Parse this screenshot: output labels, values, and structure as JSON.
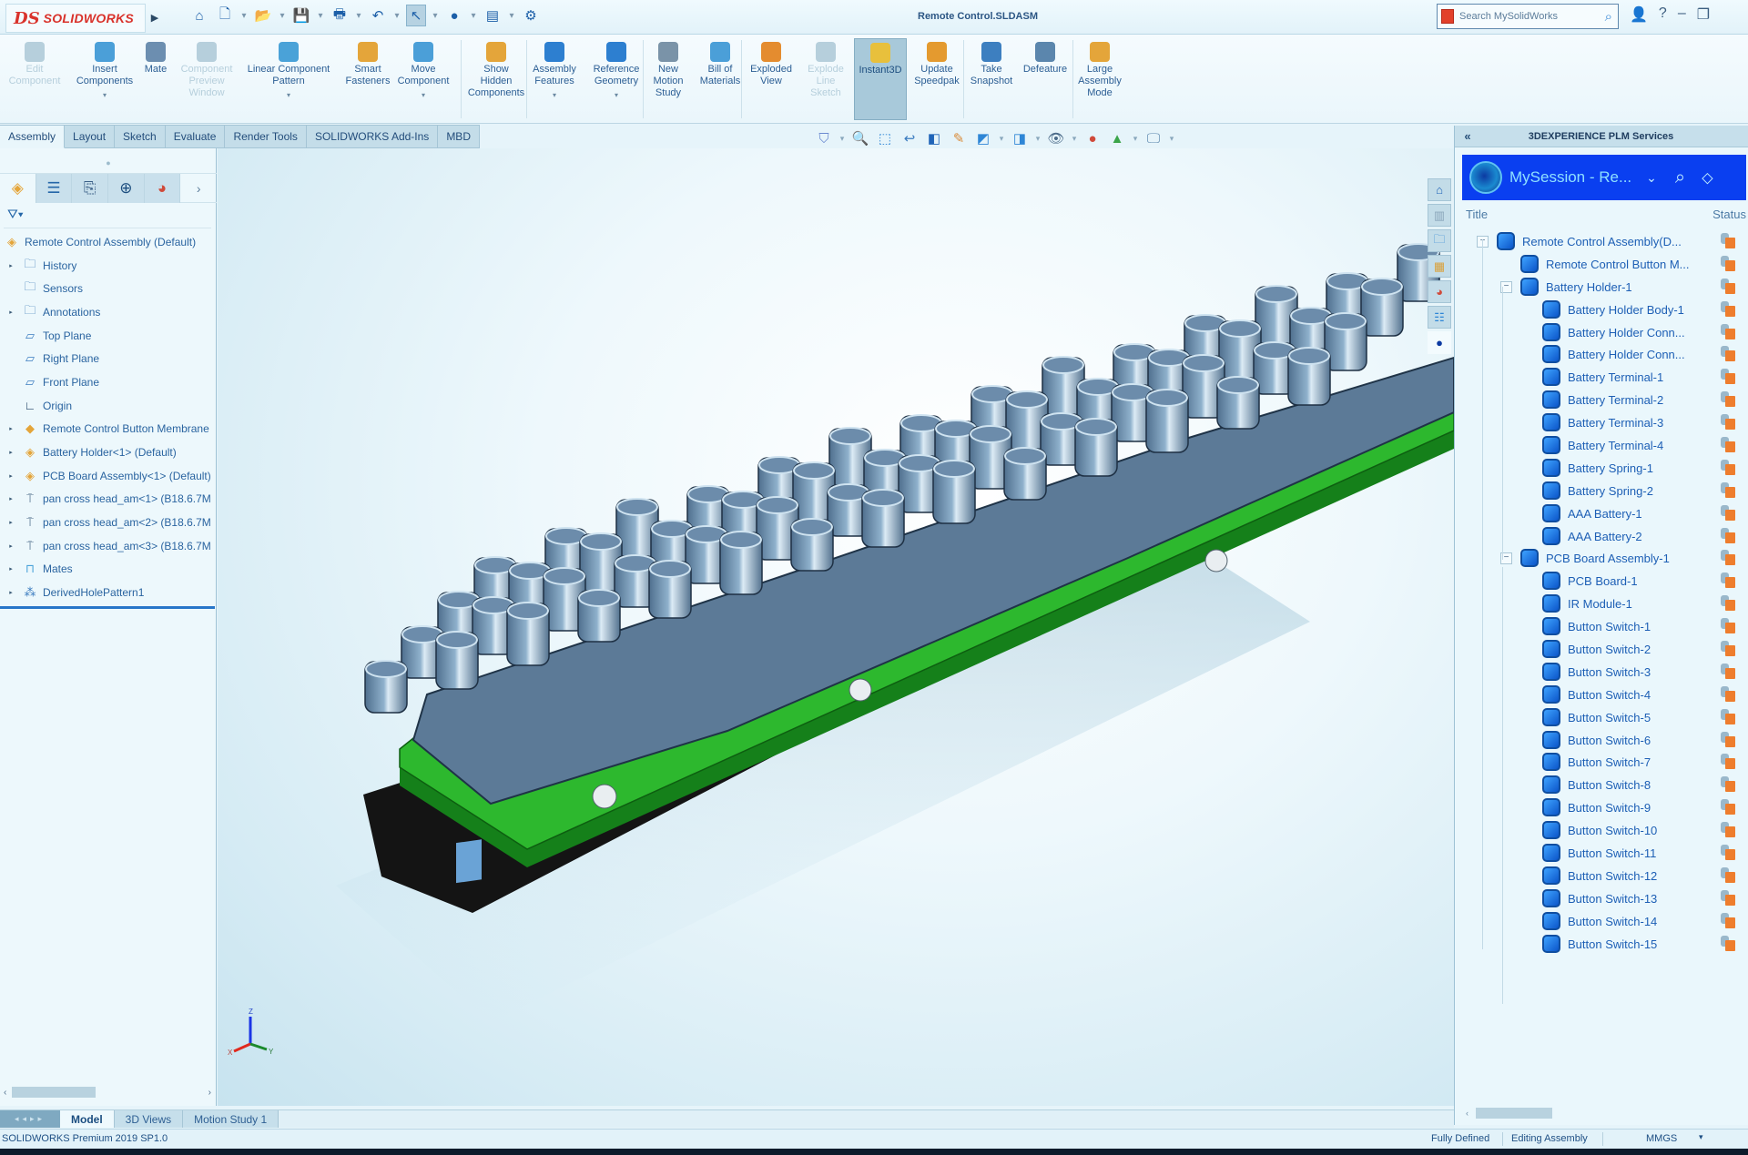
{
  "titlebar": {
    "brand_ds": "DS",
    "brand_name": "SOLIDWORKS",
    "document_title": "Remote Control.SLDASM",
    "search_placeholder": "Search MySolidWorks",
    "quick_access": [
      {
        "icon": "home-icon",
        "glyph": "⌂"
      },
      {
        "icon": "new-document-icon",
        "glyph": "🗋"
      },
      {
        "icon": "open-folder-icon",
        "glyph": "📂"
      },
      {
        "icon": "save-icon",
        "glyph": "💾"
      },
      {
        "icon": "print-icon",
        "glyph": "🖶"
      },
      {
        "icon": "undo-icon",
        "glyph": "↶"
      },
      {
        "icon": "select-cursor-icon",
        "glyph": "↖"
      },
      {
        "icon": "rebuild-icon",
        "glyph": "●"
      },
      {
        "icon": "file-properties-icon",
        "glyph": "▤"
      },
      {
        "icon": "options-gear-icon",
        "glyph": "⚙"
      }
    ]
  },
  "ribbon": {
    "buttons": [
      {
        "label": "Edit\nComponent",
        "state": "disabled",
        "icon": "edit-component-icon",
        "dropdown": false
      },
      {
        "label": "Insert\nComponents",
        "state": "normal",
        "icon": "insert-components-icon",
        "dropdown": true
      },
      {
        "label": "Mate",
        "state": "normal",
        "icon": "mate-paperclip-icon",
        "dropdown": false
      },
      {
        "label": "Component\nPreview\nWindow",
        "state": "disabled",
        "icon": "component-preview-icon",
        "dropdown": false
      },
      {
        "label": "Linear Component\nPattern",
        "state": "normal",
        "icon": "linear-pattern-icon",
        "dropdown": true
      },
      {
        "label": "Smart\nFasteners",
        "state": "normal",
        "icon": "smart-fasteners-icon",
        "dropdown": false
      },
      {
        "label": "Move\nComponent",
        "state": "normal",
        "icon": "move-component-icon",
        "dropdown": true
      },
      {
        "label": "Show\nHidden\nComponents",
        "state": "normal",
        "icon": "show-hidden-icon",
        "dropdown": false
      },
      {
        "label": "Assembly\nFeatures",
        "state": "normal",
        "icon": "assembly-features-icon",
        "dropdown": true
      },
      {
        "label": "Reference\nGeometry",
        "state": "normal",
        "icon": "reference-geometry-icon",
        "dropdown": true
      },
      {
        "label": "New\nMotion\nStudy",
        "state": "normal",
        "icon": "motion-study-icon",
        "dropdown": false
      },
      {
        "label": "Bill of\nMaterials",
        "state": "normal",
        "icon": "bill-of-materials-icon",
        "dropdown": false
      },
      {
        "label": "Exploded\nView",
        "state": "normal",
        "icon": "exploded-view-icon",
        "dropdown": false
      },
      {
        "label": "Explode\nLine\nSketch",
        "state": "disabled",
        "icon": "explode-line-sketch-icon",
        "dropdown": false
      },
      {
        "label": "Instant3D",
        "state": "active",
        "icon": "instant3d-icon",
        "dropdown": false
      },
      {
        "label": "Update\nSpeedpak",
        "state": "normal",
        "icon": "speedpak-icon",
        "dropdown": false
      },
      {
        "label": "Take\nSnapshot",
        "state": "normal",
        "icon": "camera-icon",
        "dropdown": false
      },
      {
        "label": "Defeature",
        "state": "normal",
        "icon": "defeature-icon",
        "dropdown": false
      },
      {
        "label": "Large\nAssembly\nMode",
        "state": "normal",
        "icon": "large-assembly-icon",
        "dropdown": false
      }
    ]
  },
  "command_tabs": [
    {
      "label": "Assembly",
      "active": true
    },
    {
      "label": "Layout",
      "active": false
    },
    {
      "label": "Sketch",
      "active": false
    },
    {
      "label": "Evaluate",
      "active": false
    },
    {
      "label": "Render Tools",
      "active": false
    },
    {
      "label": "SOLIDWORKS Add-Ins",
      "active": false
    },
    {
      "label": "MBD",
      "active": false
    }
  ],
  "heads_up_toolbar": [
    "view-filter-icon",
    "zoom-to-fit-icon",
    "zoom-to-area-icon",
    "previous-view-icon",
    "section-view-icon",
    "dynamic-annotation-icon",
    "view-orientation-icon",
    "display-style-icon",
    "hide-show-icon",
    "edit-appearance-icon",
    "apply-scene-icon",
    "view-settings-icon"
  ],
  "feature_manager": {
    "tabs": [
      "feature-manager-icon",
      "property-manager-icon",
      "configuration-manager-icon",
      "dimxpert-icon",
      "display-manager-icon"
    ],
    "filter_icon": "filter-funnel-icon",
    "tree": [
      {
        "label": "Remote Control Assembly  (Default)",
        "icon": "assembly-icon",
        "expander": false,
        "indent": 0
      },
      {
        "label": "History",
        "icon": "history-folder-icon",
        "expander": true,
        "indent": 1
      },
      {
        "label": "Sensors",
        "icon": "sensors-folder-icon",
        "expander": false,
        "indent": 1
      },
      {
        "label": "Annotations",
        "icon": "annotations-folder-icon",
        "expander": true,
        "indent": 1
      },
      {
        "label": "Top Plane",
        "icon": "plane-icon",
        "expander": false,
        "indent": 1
      },
      {
        "label": "Right Plane",
        "icon": "plane-icon",
        "expander": false,
        "indent": 1
      },
      {
        "label": "Front Plane",
        "icon": "plane-icon",
        "expander": false,
        "indent": 1
      },
      {
        "label": "Origin",
        "icon": "origin-icon",
        "expander": false,
        "indent": 1
      },
      {
        "label": "Remote Control Button Membrane",
        "icon": "part-icon",
        "expander": true,
        "indent": 1
      },
      {
        "label": "Battery Holder<1> (Default)",
        "icon": "subassembly-icon",
        "expander": true,
        "indent": 1
      },
      {
        "label": "PCB Board Assembly<1> (Default)",
        "icon": "subassembly-icon",
        "expander": true,
        "indent": 1
      },
      {
        "label": "pan cross head_am<1> (B18.6.7M",
        "icon": "screw-icon",
        "expander": true,
        "indent": 1
      },
      {
        "label": "pan cross head_am<2> (B18.6.7M",
        "icon": "screw-icon",
        "expander": true,
        "indent": 1
      },
      {
        "label": "pan cross head_am<3> (B18.6.7M",
        "icon": "screw-icon",
        "expander": true,
        "indent": 1
      },
      {
        "label": "Mates",
        "icon": "mates-icon",
        "expander": true,
        "indent": 1
      },
      {
        "label": "DerivedHolePattern1",
        "icon": "derived-pattern-icon",
        "expander": true,
        "indent": 1
      }
    ]
  },
  "viewport": {
    "triad_labels": {
      "x": "X",
      "y": "Y",
      "z": "Z"
    },
    "colors": {
      "pcb": "#29b32b",
      "membrane": "#5d7b96",
      "background": "#e8f5fa"
    }
  },
  "view_bar": [
    "home-icon",
    "3d-library-icon",
    "file-explorer-icon",
    "view-palette-icon",
    "appearances-icon",
    "custom-properties-icon",
    "3dexperience-icon"
  ],
  "task_pane": {
    "header_title": "3DEXPERIENCE PLM Services",
    "session_name": "MySession - Re...",
    "col_title": "Title",
    "col_status": "Status",
    "tree": [
      {
        "label": "Remote Control Assembly(D...",
        "level": 0,
        "expander": "−"
      },
      {
        "label": "Remote Control Button M...",
        "level": 1,
        "expander": ""
      },
      {
        "label": "Battery Holder-1",
        "level": 1,
        "expander": "−"
      },
      {
        "label": "Battery Holder Body-1",
        "level": 2,
        "expander": ""
      },
      {
        "label": "Battery Holder Conn...",
        "level": 2,
        "expander": ""
      },
      {
        "label": "Battery Holder Conn...",
        "level": 2,
        "expander": ""
      },
      {
        "label": "Battery Terminal-1",
        "level": 2,
        "expander": ""
      },
      {
        "label": "Battery Terminal-2",
        "level": 2,
        "expander": ""
      },
      {
        "label": "Battery Terminal-3",
        "level": 2,
        "expander": ""
      },
      {
        "label": "Battery Terminal-4",
        "level": 2,
        "expander": ""
      },
      {
        "label": "Battery Spring-1",
        "level": 2,
        "expander": ""
      },
      {
        "label": "Battery Spring-2",
        "level": 2,
        "expander": ""
      },
      {
        "label": "AAA Battery-1",
        "level": 2,
        "expander": ""
      },
      {
        "label": "AAA Battery-2",
        "level": 2,
        "expander": ""
      },
      {
        "label": "PCB Board Assembly-1",
        "level": 1,
        "expander": "−"
      },
      {
        "label": "PCB Board-1",
        "level": 2,
        "expander": ""
      },
      {
        "label": "IR Module-1",
        "level": 2,
        "expander": ""
      },
      {
        "label": "Button Switch-1",
        "level": 2,
        "expander": ""
      },
      {
        "label": "Button Switch-2",
        "level": 2,
        "expander": ""
      },
      {
        "label": "Button Switch-3",
        "level": 2,
        "expander": ""
      },
      {
        "label": "Button Switch-4",
        "level": 2,
        "expander": ""
      },
      {
        "label": "Button Switch-5",
        "level": 2,
        "expander": ""
      },
      {
        "label": "Button Switch-6",
        "level": 2,
        "expander": ""
      },
      {
        "label": "Button Switch-7",
        "level": 2,
        "expander": ""
      },
      {
        "label": "Button Switch-8",
        "level": 2,
        "expander": ""
      },
      {
        "label": "Button Switch-9",
        "level": 2,
        "expander": ""
      },
      {
        "label": "Button Switch-10",
        "level": 2,
        "expander": ""
      },
      {
        "label": "Button Switch-11",
        "level": 2,
        "expander": ""
      },
      {
        "label": "Button Switch-12",
        "level": 2,
        "expander": ""
      },
      {
        "label": "Button Switch-13",
        "level": 2,
        "expander": ""
      },
      {
        "label": "Button Switch-14",
        "level": 2,
        "expander": ""
      },
      {
        "label": "Button Switch-15",
        "level": 2,
        "expander": ""
      }
    ]
  },
  "bottom_tabs": [
    {
      "label": "Model",
      "active": true
    },
    {
      "label": "3D Views",
      "active": false
    },
    {
      "label": "Motion Study 1",
      "active": false
    }
  ],
  "statusbar": {
    "product": "SOLIDWORKS Premium 2019 SP1.0",
    "definition_state": "Fully Defined",
    "mode": "Editing Assembly",
    "units": "MMGS",
    "units_dropdown": "▾"
  }
}
